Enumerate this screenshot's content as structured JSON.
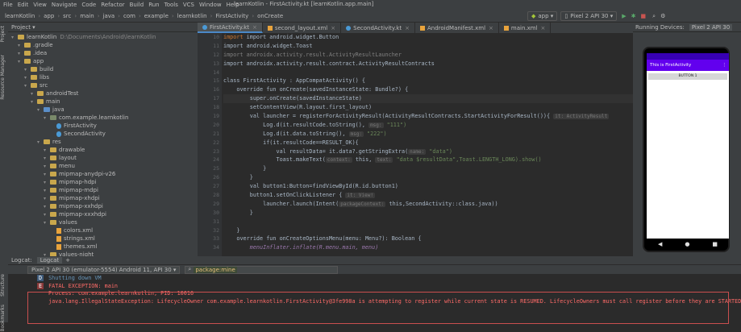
{
  "menu": {
    "items": [
      "File",
      "Edit",
      "View",
      "Navigate",
      "Code",
      "Refactor",
      "Build",
      "Run",
      "Tools",
      "VCS",
      "Window",
      "Help"
    ],
    "window_title": "learnKotlin - FirstActivity.kt [learnKotlin.app.main]"
  },
  "breadcrumb": [
    "learnKotlin",
    "app",
    "src",
    "main",
    "java",
    "com",
    "example",
    "learnkotlin",
    "FirstActivity",
    "onCreate"
  ],
  "toolbar": {
    "config": "app",
    "device": "Pixel 2 API 30"
  },
  "project": {
    "title": "Project",
    "tree": [
      {
        "label": "learnKotlin",
        "extra": "D:\\Documents\\Android\\learnKotlin",
        "indent": 0,
        "type": "folder"
      },
      {
        "label": ".gradle",
        "indent": 1,
        "type": "folder"
      },
      {
        "label": ".idea",
        "indent": 1,
        "type": "folder"
      },
      {
        "label": "app",
        "indent": 1,
        "type": "folder"
      },
      {
        "label": "build",
        "indent": 2,
        "type": "folder"
      },
      {
        "label": "libs",
        "indent": 2,
        "type": "folder"
      },
      {
        "label": "src",
        "indent": 2,
        "type": "folder"
      },
      {
        "label": "androidTest",
        "indent": 3,
        "type": "folder"
      },
      {
        "label": "main",
        "indent": 3,
        "type": "folder"
      },
      {
        "label": "java",
        "indent": 4,
        "type": "folderb"
      },
      {
        "label": "com.example.learnkotlin",
        "indent": 5,
        "type": "folderg"
      },
      {
        "label": "FirstActivity",
        "indent": 6,
        "type": "kt"
      },
      {
        "label": "SecondActivity",
        "indent": 6,
        "type": "kt"
      },
      {
        "label": "res",
        "indent": 4,
        "type": "folder"
      },
      {
        "label": "drawable",
        "indent": 5,
        "type": "folder"
      },
      {
        "label": "layout",
        "indent": 5,
        "type": "folder"
      },
      {
        "label": "menu",
        "indent": 5,
        "type": "folder"
      },
      {
        "label": "mipmap-anydpi-v26",
        "indent": 5,
        "type": "folder"
      },
      {
        "label": "mipmap-hdpi",
        "indent": 5,
        "type": "folder"
      },
      {
        "label": "mipmap-mdpi",
        "indent": 5,
        "type": "folder"
      },
      {
        "label": "mipmap-xhdpi",
        "indent": 5,
        "type": "folder"
      },
      {
        "label": "mipmap-xxhdpi",
        "indent": 5,
        "type": "folder"
      },
      {
        "label": "mipmap-xxxhdpi",
        "indent": 5,
        "type": "folder"
      },
      {
        "label": "values",
        "indent": 5,
        "type": "folder"
      },
      {
        "label": "colors.xml",
        "indent": 6,
        "type": "xml"
      },
      {
        "label": "strings.xml",
        "indent": 6,
        "type": "xml"
      },
      {
        "label": "themes.xml",
        "indent": 6,
        "type": "xml"
      },
      {
        "label": "values-night",
        "indent": 5,
        "type": "folder"
      }
    ]
  },
  "tabs": [
    "FirstActivity.kt",
    "second_layout.xml",
    "SecondActivity.kt",
    "AndroidManifest.xml",
    "main.xml"
  ],
  "line_numbers": [
    10,
    11,
    12,
    13,
    14,
    15,
    16,
    17,
    18,
    19,
    20,
    21,
    22,
    23,
    24,
    25,
    26,
    27,
    28,
    29,
    30,
    31,
    32,
    33,
    34
  ],
  "code": {
    "l10": "import android.widget.Button",
    "l11": "import android.widget.Toast",
    "l12": "import androidx.activity.result.ActivityResultLauncher",
    "l13": "import androidx.activity.result.contract.ActivityResultContracts",
    "l15": "class FirstActivity : AppCompatActivity() {",
    "l16": "    override fun onCreate(savedInstanceState: Bundle?) {",
    "l17": "        super.onCreate(savedInstanceState)",
    "l18": "        setContentView(R.layout.first_layout)",
    "l19": "        val launcher = registerForActivityResult(ActivityResultContracts.StartActivityForResult()){",
    "l19hint": "it: ActivityResult",
    "l20": "            Log.d(it.resultCode.toString(),",
    "l20hint": "msg:",
    "l20s": " \"111\")",
    "l21": "            Log.d(it.data.toString(),",
    "l21hint": "msg:",
    "l21s": " \"222\")",
    "l22": "            if(it.resultCode==RESULT_OK){",
    "l23": "                val resultData= it.data?.getStringExtra(",
    "l23hint": "name:",
    "l23s": " \"data\")",
    "l24": "                Toast.makeText(",
    "l24hint1": "context:",
    "l24m": " this, ",
    "l24hint2": "text:",
    "l24s": " \"data $resultData\",Toast.LENGTH_LONG).show()",
    "l25": "            }",
    "l26": "        }",
    "l27": "        val button1:Button=findViewById(R.id.button1)",
    "l28": "        button1.setOnClickListener {",
    "l28hint": "it: View!",
    "l29": "            launcher.launch(Intent(",
    "l29hint": "packageContext:",
    "l29s": " this,SecondActivity::class.java))",
    "l30": "        }",
    "l32": "    }",
    "l33": "    override fun onCreateOptionsMenu(menu: Menu?): Boolean {",
    "l34": "        menuInflater.inflate(R.menu.main, menu)"
  },
  "device": {
    "title": "Running Devices:",
    "tab": "Pixel 2 API 30",
    "app_title": "This is FirstActivity",
    "button": "BUTTON 1"
  },
  "logcat": {
    "title": "Logcat:",
    "tab": "Logcat",
    "device": "Pixel 2 API 30 (emulator-5554) Android 11, API 30",
    "filter": "package:mine",
    "lines": [
      {
        "level": "D",
        "text": "Shutting down VM"
      },
      {
        "level": "E",
        "text": "FATAL EXCEPTION: main"
      },
      {
        "level": "E",
        "text": "Process: com.example.learnkotlin, PID: 10016"
      },
      {
        "level": "E",
        "text": "java.lang.IllegalStateException: LifecycleOwner com.example.learnkotlin.FirstActivity@3fe998a is attempting to register while current state is RESUMED. LifecycleOwners must call register before they are STARTED."
      }
    ]
  },
  "sidebar_labels": [
    "Project",
    "Resource Manager",
    "Structure",
    "Bookmarks"
  ]
}
